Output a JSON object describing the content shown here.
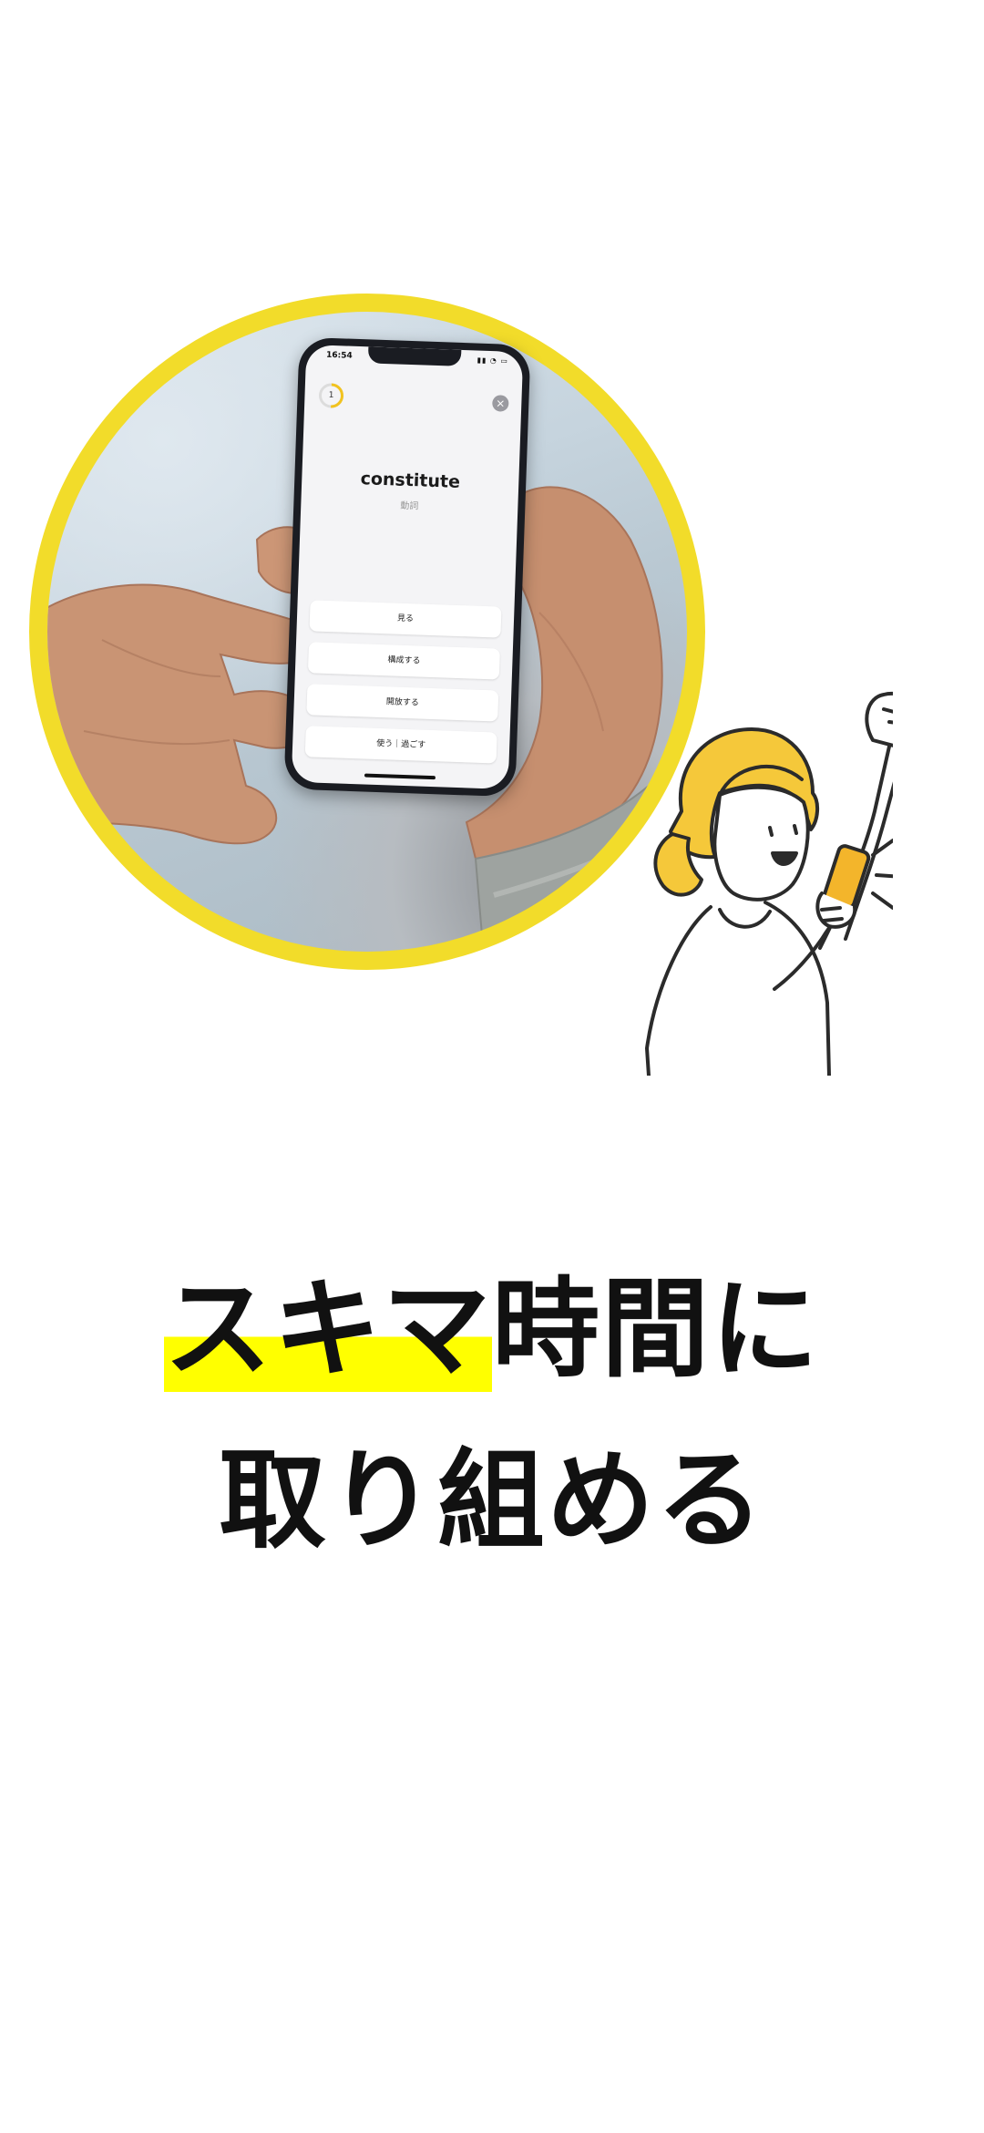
{
  "app_screen": {
    "status_time": "16:54",
    "progress_count": "1",
    "word": "constitute",
    "part_of_speech": "動詞",
    "choices": [
      "見る",
      "構成する",
      "開放する",
      "使う｜過ごす"
    ]
  },
  "headline": {
    "line1_highlight": "スキマ",
    "line1_rest": "時間に",
    "line2": "取り組める"
  },
  "colors": {
    "ring": "#f2dc2a",
    "highlight": "#ffff00",
    "illustration_hair": "#f5c83a",
    "illustration_phone": "#f3b52b"
  },
  "icons": {
    "close": "close-icon",
    "illustration": "woman-cheering-with-phone"
  }
}
